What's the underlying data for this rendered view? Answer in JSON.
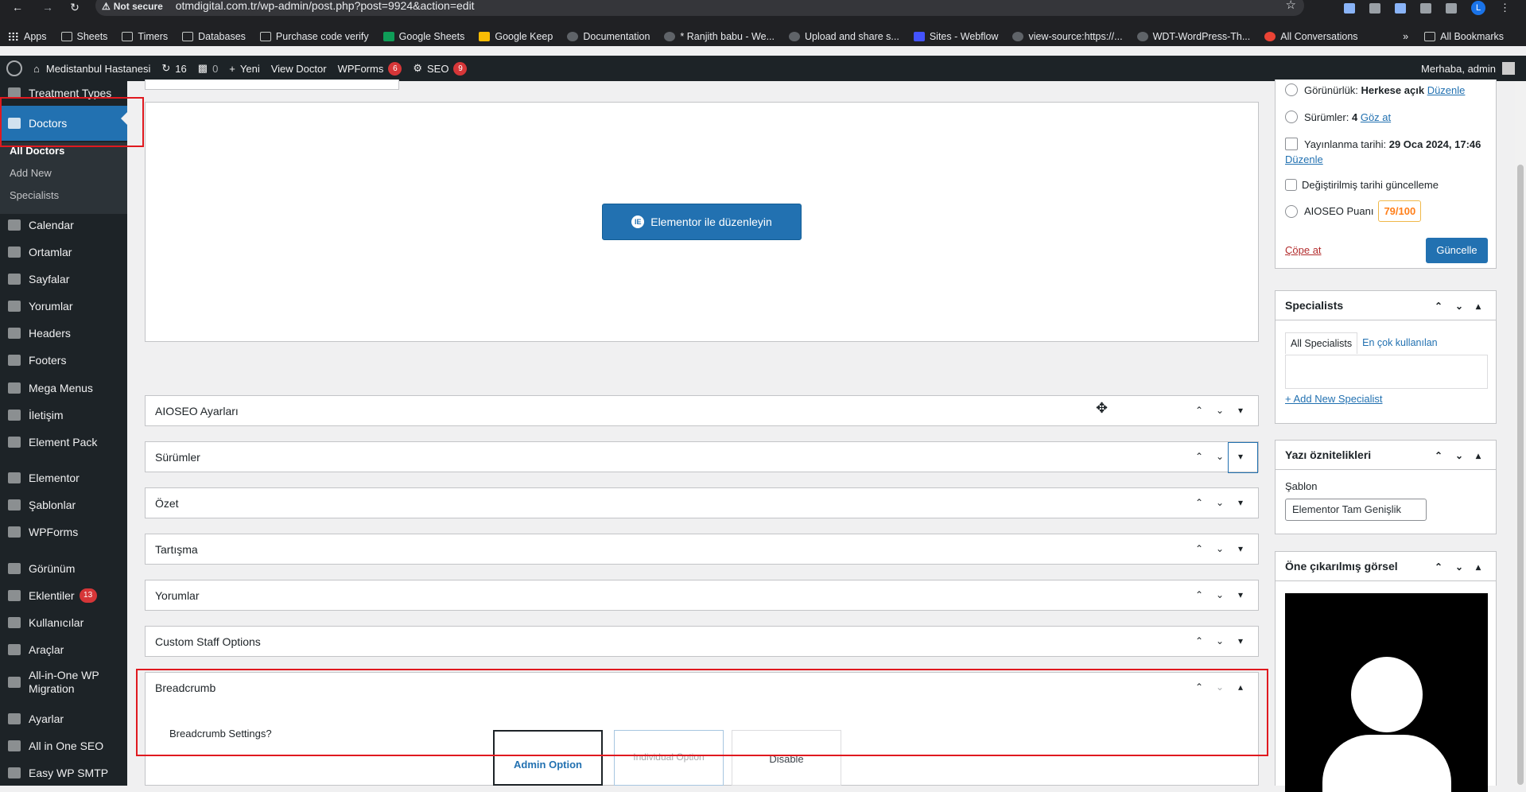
{
  "browser": {
    "security_label": "Not secure",
    "url": "otmdigital.com.tr/wp-admin/post.php?post=9924&action=edit",
    "avatar_letter": "L",
    "bookmarks": [
      "Apps",
      "Sheets",
      "Timers",
      "Databases",
      "Purchase code verify",
      "Google Sheets",
      "Google Keep",
      "Documentation",
      "* Ranjith babu - We...",
      "Upload and share s...",
      "Sites - Webflow",
      "view-source:https://...",
      "WDT-WordPress-Th...",
      "All Conversations"
    ],
    "more_label": "»",
    "all_bookmarks": "All Bookmarks"
  },
  "adminbar": {
    "site_name": "Medistanbul Hastanesi",
    "updates": "16",
    "comments": "0",
    "new_label": "Yeni",
    "view_label": "View Doctor",
    "wpforms_label": "WPForms",
    "wpforms_count": "6",
    "seo_label": "SEO",
    "seo_count": "9",
    "greeting": "Merhaba, admin"
  },
  "sidebar": {
    "top_partial": "Treatment Types",
    "active": "Doctors",
    "submenu": [
      "All Doctors",
      "Add New",
      "Specialists"
    ],
    "items": [
      "Calendar",
      "Ortamlar",
      "Sayfalar",
      "Yorumlar",
      "Headers",
      "Footers",
      "Mega Menus",
      "İletişim",
      "Element Pack",
      "Elementor",
      "Şablonlar",
      "WPForms",
      "Görünüm",
      "Eklentiler",
      "Kullanıcılar",
      "Araçlar",
      "All-in-One WP Migration",
      "Ayarlar",
      "All in One SEO",
      "Easy WP SMTP"
    ],
    "plugins_count": "13"
  },
  "editor": {
    "elementor_button": "Elementor ile düzenleyin",
    "metaboxes": [
      "AIOSEO Ayarları",
      "Sürümler",
      "Özet",
      "Tartışma",
      "Yorumlar",
      "Custom Staff Options",
      "Breadcrumb"
    ],
    "breadcrumb_settings_label": "Breadcrumb Settings?",
    "options": [
      "Admin Option",
      "Individual Option",
      "Disable"
    ]
  },
  "publish": {
    "visibility_label": "Görünürlük:",
    "visibility_value": "Herkese açık",
    "visibility_edit": "Düzenle",
    "revisions_label": "Sürümler:",
    "revisions_value": "4",
    "revisions_link": "Göz at",
    "published_label": "Yayınlanma tarihi:",
    "published_value": "29 Oca 2024, 17:46",
    "published_edit": "Düzenle",
    "modified_checkbox": "Değiştirilmiş tarihi güncelleme",
    "aioseo_label": "AIOSEO Puanı",
    "aioseo_score": "79/100",
    "trash": "Çöpe at",
    "update": "Güncelle"
  },
  "specialists": {
    "title": "Specialists",
    "tab_all": "All Specialists",
    "tab_popular": "En çok kullanılan",
    "add_new": "+ Add New Specialist"
  },
  "attributes": {
    "title": "Yazı öznitelikleri",
    "template_label": "Şablon",
    "template_value": "Elementor Tam Genişlik"
  },
  "featured": {
    "title": "Öne çıkarılmış görsel"
  },
  "colors": {
    "accent": "#2271b1",
    "admin_dark": "#1d2327",
    "highlight_red": "#e0191f"
  }
}
